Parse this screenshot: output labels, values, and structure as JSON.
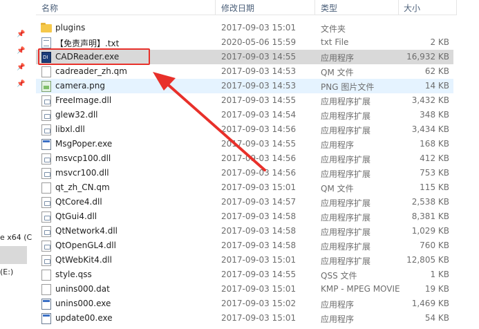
{
  "header": {
    "col_name": "名称",
    "col_date": "修改日期",
    "col_type": "类型",
    "col_size": "大小"
  },
  "nav": {
    "cut_label_1": "e x64 (C",
    "cut_label_2": "(E:)"
  },
  "files": [
    {
      "name": "plugins",
      "date": "2017-09-03 15:01",
      "type": "文件夹",
      "size": "",
      "icon": "folder-icon"
    },
    {
      "name": "【免责声明】.txt",
      "date": "2020-05-06 15:59",
      "type": "txt File",
      "size": "2 KB",
      "icon": "text-file-icon"
    },
    {
      "name": "CADReader.exe",
      "date": "2017-09-03 14:55",
      "type": "应用程序",
      "size": "16,932 KB",
      "icon": "cadreader-app-icon"
    },
    {
      "name": "cadreader_zh.qm",
      "date": "2017-09-03 14:53",
      "type": "QM 文件",
      "size": "62 KB",
      "icon": "blank-file-icon"
    },
    {
      "name": "camera.png",
      "date": "2017-09-03 14:53",
      "type": "PNG 图片文件",
      "size": "14 KB",
      "icon": "png-image-icon"
    },
    {
      "name": "FreeImage.dll",
      "date": "2017-09-03 14:55",
      "type": "应用程序扩展",
      "size": "3,432 KB",
      "icon": "dll-file-icon"
    },
    {
      "name": "glew32.dll",
      "date": "2017-09-03 14:54",
      "type": "应用程序扩展",
      "size": "348 KB",
      "icon": "dll-file-icon"
    },
    {
      "name": "libxl.dll",
      "date": "2017-09-03 14:56",
      "type": "应用程序扩展",
      "size": "3,434 KB",
      "icon": "dll-file-icon"
    },
    {
      "name": "MsgPoper.exe",
      "date": "2017-09-03 14:55",
      "type": "应用程序",
      "size": "168 KB",
      "icon": "exe-file-icon"
    },
    {
      "name": "msvcp100.dll",
      "date": "2017-09-03 14:56",
      "type": "应用程序扩展",
      "size": "412 KB",
      "icon": "dll-file-icon"
    },
    {
      "name": "msvcr100.dll",
      "date": "2017-09-03 14:56",
      "type": "应用程序扩展",
      "size": "753 KB",
      "icon": "dll-file-icon"
    },
    {
      "name": "qt_zh_CN.qm",
      "date": "2017-09-03 15:01",
      "type": "QM 文件",
      "size": "115 KB",
      "icon": "blank-file-icon"
    },
    {
      "name": "QtCore4.dll",
      "date": "2017-09-03 14:57",
      "type": "应用程序扩展",
      "size": "2,538 KB",
      "icon": "dll-file-icon"
    },
    {
      "name": "QtGui4.dll",
      "date": "2017-09-03 14:58",
      "type": "应用程序扩展",
      "size": "8,381 KB",
      "icon": "dll-file-icon"
    },
    {
      "name": "QtNetwork4.dll",
      "date": "2017-09-03 14:58",
      "type": "应用程序扩展",
      "size": "1,029 KB",
      "icon": "dll-file-icon"
    },
    {
      "name": "QtOpenGL4.dll",
      "date": "2017-09-03 14:58",
      "type": "应用程序扩展",
      "size": "760 KB",
      "icon": "dll-file-icon"
    },
    {
      "name": "QtWebKit4.dll",
      "date": "2017-09-03 15:01",
      "type": "应用程序扩展",
      "size": "12,805 KB",
      "icon": "dll-file-icon"
    },
    {
      "name": "style.qss",
      "date": "2017-09-03 14:55",
      "type": "QSS 文件",
      "size": "1 KB",
      "icon": "blank-file-icon"
    },
    {
      "name": "unins000.dat",
      "date": "2017-09-03 15:01",
      "type": "KMP - MPEG MOVIE",
      "size": "19 KB",
      "icon": "blank-file-icon"
    },
    {
      "name": "unins000.exe",
      "date": "2017-09-03 15:02",
      "type": "应用程序",
      "size": "1,469 KB",
      "icon": "installer-exe-icon"
    },
    {
      "name": "update00.exe",
      "date": "2017-09-03 15:01",
      "type": "应用程序",
      "size": "54 KB",
      "icon": "exe-file-icon"
    }
  ],
  "colors": {
    "highlight_red": "#e8302a",
    "selected_row": "#d9d9d9",
    "hover_row": "#e5f3ff",
    "header_text": "#4c607a"
  }
}
